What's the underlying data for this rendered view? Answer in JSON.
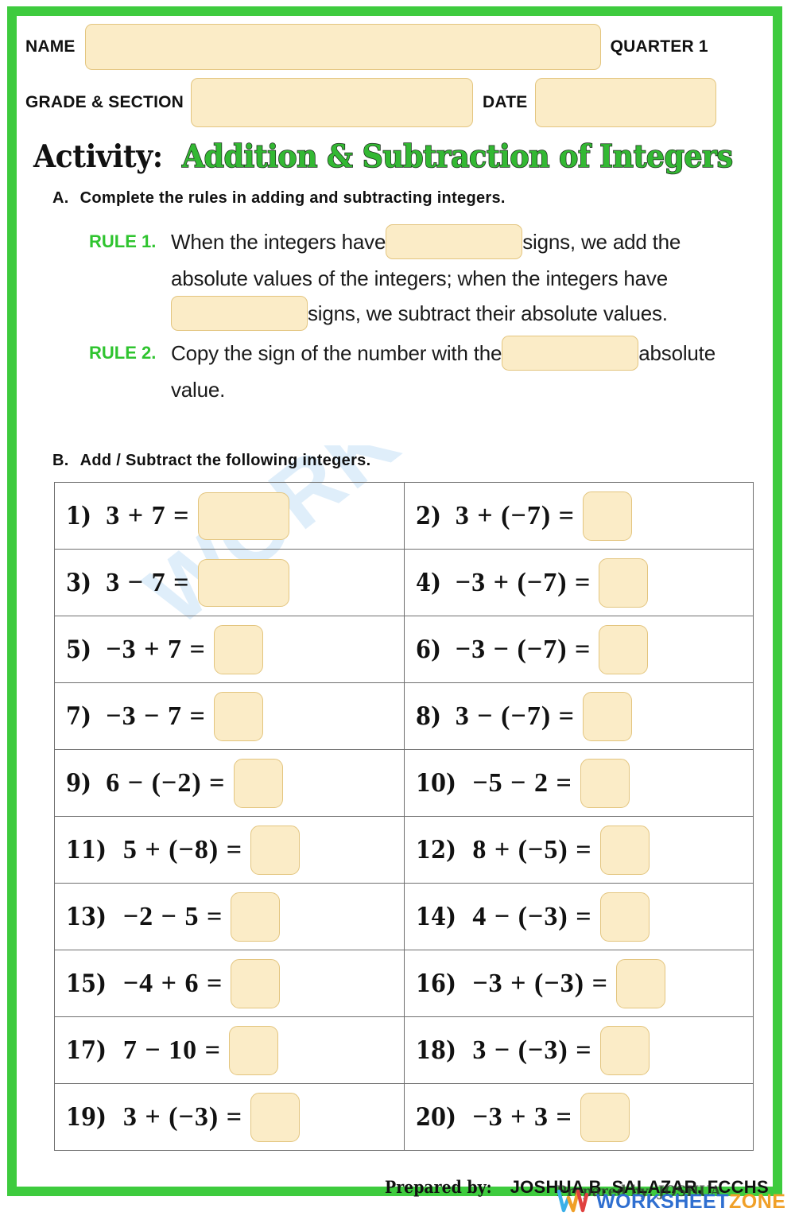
{
  "header": {
    "name_label": "NAME",
    "quarter_label": "QUARTER 1",
    "grade_label": "GRADE & SECTION",
    "date_label": "DATE",
    "name_value": "",
    "grade_value": "",
    "date_value": ""
  },
  "activity": {
    "prefix": "Activity:",
    "title": "Addition & Subtraction of Integers",
    "title_color": "#33b833"
  },
  "section_a": {
    "letter": "A.",
    "heading": "Complete the rules in adding and subtracting integers.",
    "rules": [
      {
        "label": "RULE 1.",
        "part1": "When the integers have",
        "part2": "signs, we add the absolute values of the integers; when the integers have",
        "part3": "signs, we subtract their absolute values.",
        "blank1_value": "",
        "blank2_value": ""
      },
      {
        "label": "RULE 2.",
        "part1": "Copy the sign of the number with the",
        "part2": "absolute value.",
        "blank1_value": ""
      }
    ]
  },
  "section_b": {
    "letter": "B.",
    "heading": "Add / Subtract the following integers.",
    "problems": [
      {
        "num": "1)",
        "expr": "3 + 7 =",
        "answer": "",
        "wide": true
      },
      {
        "num": "2)",
        "expr": "3 + (−7) =",
        "answer": "",
        "wide": false
      },
      {
        "num": "3)",
        "expr": "3 − 7 =",
        "answer": "",
        "wide": true
      },
      {
        "num": "4)",
        "expr": "−3 + (−7) =",
        "answer": "",
        "wide": false
      },
      {
        "num": "5)",
        "expr": "−3 + 7 =",
        "answer": "",
        "wide": false
      },
      {
        "num": "6)",
        "expr": "−3 − (−7) =",
        "answer": "",
        "wide": false
      },
      {
        "num": "7)",
        "expr": "−3 − 7 =",
        "answer": "",
        "wide": false
      },
      {
        "num": "8)",
        "expr": "3 − (−7) =",
        "answer": "",
        "wide": false
      },
      {
        "num": "9)",
        "expr": "6 − (−2) =",
        "answer": "",
        "wide": false
      },
      {
        "num": "10)",
        "expr": "−5 − 2 =",
        "answer": "",
        "wide": false
      },
      {
        "num": "11)",
        "expr": "5 + (−8) =",
        "answer": "",
        "wide": false
      },
      {
        "num": "12)",
        "expr": "8 + (−5) =",
        "answer": "",
        "wide": false
      },
      {
        "num": "13)",
        "expr": "−2 − 5 =",
        "answer": "",
        "wide": false
      },
      {
        "num": "14)",
        "expr": "4 − (−3) =",
        "answer": "",
        "wide": false
      },
      {
        "num": "15)",
        "expr": "−4 + 6 =",
        "answer": "",
        "wide": false
      },
      {
        "num": "16)",
        "expr": "−3 + (−3) =",
        "answer": "",
        "wide": false
      },
      {
        "num": "17)",
        "expr": "7 − 10 =",
        "answer": "",
        "wide": false
      },
      {
        "num": "18)",
        "expr": "3 − (−3) =",
        "answer": "",
        "wide": false
      },
      {
        "num": "19)",
        "expr": "3 + (−3) =",
        "answer": "",
        "wide": false
      },
      {
        "num": "20)",
        "expr": "−3 + 3 =",
        "answer": "",
        "wide": false
      }
    ]
  },
  "footer": {
    "prepared_label": "Prepared by:",
    "prepared_name": "JOSHUA B. SALAZAR, FCCHS",
    "prepared_ghost": "Prepared by: JOSHUA",
    "brand_part1": "WORKSHEET",
    "brand_part2": "ZONE"
  },
  "watermark": {
    "diagonal_text": "WORKSHEETZONE"
  },
  "colors": {
    "frame_green": "#3ecb3e",
    "accent_green": "#2fc42f",
    "blank_fill": "#fbecc7",
    "blank_border": "#e3c57f",
    "table_border": "#6f6f6f"
  }
}
